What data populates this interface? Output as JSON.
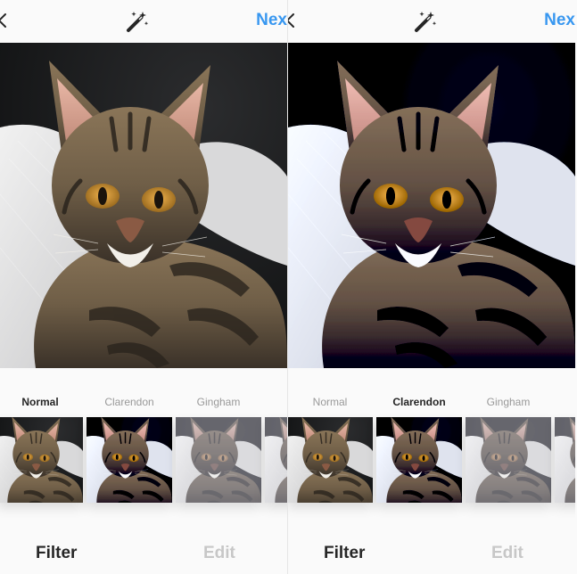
{
  "colors": {
    "accent": "#3897f0",
    "active_text": "#262626",
    "inactive_text": "#999999",
    "disabled_tab": "#c7c7c7"
  },
  "icons": {
    "back": "chevron-left-icon",
    "magic": "magic-wand-icon"
  },
  "screens": [
    {
      "next_label": "Nex",
      "selected_filter": "Normal",
      "filters": [
        "Normal",
        "Clarendon",
        "Gingham"
      ],
      "tabs": {
        "filter": "Filter",
        "edit": "Edit"
      }
    },
    {
      "next_label": "Nex",
      "selected_filter": "Clarendon",
      "filters": [
        "Normal",
        "Clarendon",
        "Gingham"
      ],
      "tabs": {
        "filter": "Filter",
        "edit": "Edit"
      }
    }
  ]
}
